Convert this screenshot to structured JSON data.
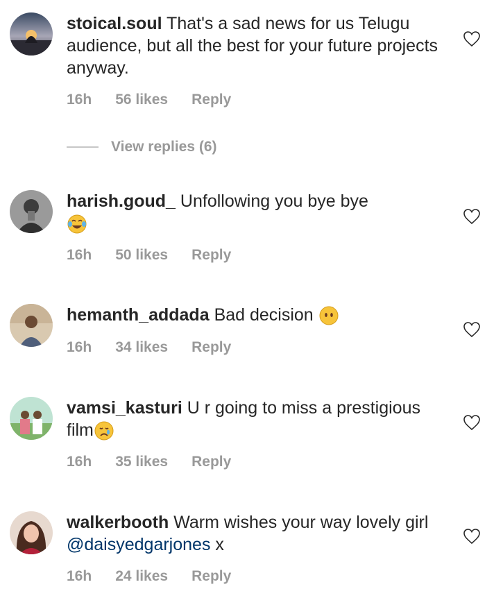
{
  "icons": {
    "like": "heart-outline-icon"
  },
  "colors": {
    "username": "#262626",
    "meta": "#999999",
    "mention": "#003569"
  },
  "comments": [
    {
      "username": "stoical.soul",
      "text": "That's a sad news for us Telugu audience, but all the best for your future projects anyway.",
      "time": "16h",
      "likes": "56 likes",
      "reply": "Reply",
      "view_replies": "View replies (6)"
    },
    {
      "username": "harish.goud_",
      "text": "Unfollowing you bye bye",
      "emoji": "face-with-tears-of-joy",
      "time": "16h",
      "likes": "50 likes",
      "reply": "Reply"
    },
    {
      "username": "hemanth_addada",
      "text": "Bad decision",
      "emoji": "face-without-mouth",
      "time": "16h",
      "likes": "34 likes",
      "reply": "Reply"
    },
    {
      "username": "vamsi_kasturi",
      "text": "U r going to miss a prestigious film",
      "emoji": "crying-face",
      "time": "16h",
      "likes": "35 likes",
      "reply": "Reply"
    },
    {
      "username": "walkerbooth",
      "text": "Warm wishes your way lovely girl",
      "mention": "@daisyedgarjones",
      "suffix": "x",
      "time": "16h",
      "likes": "24 likes",
      "reply": "Reply"
    }
  ]
}
